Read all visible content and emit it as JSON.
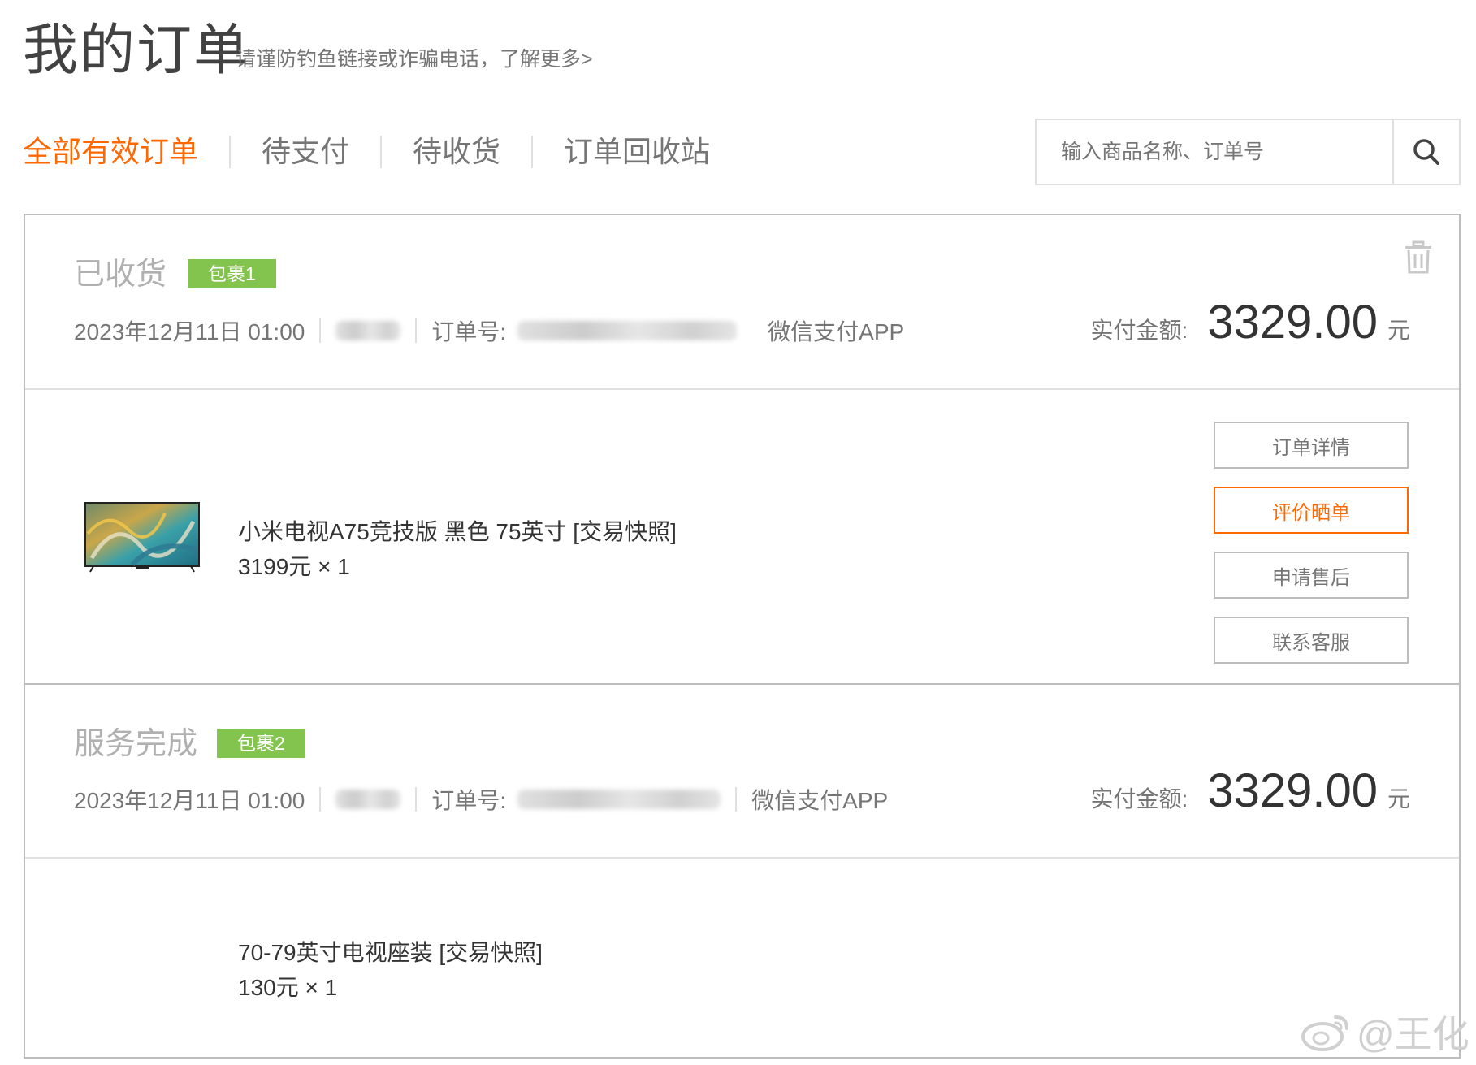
{
  "header": {
    "title": "我的订单",
    "warning_link": "请谨防钓鱼链接或诈骗电话，了解更多>"
  },
  "tabs": [
    {
      "label": "全部有效订单",
      "active": true
    },
    {
      "label": "待支付",
      "active": false
    },
    {
      "label": "待收货",
      "active": false
    },
    {
      "label": "订单回收站",
      "active": false
    }
  ],
  "search": {
    "placeholder": "输入商品名称、订单号",
    "icon": "search-icon"
  },
  "colors": {
    "accent": "#ff6700",
    "badge": "#83c44e",
    "status_text": "#b0b0b0"
  },
  "orders": [
    {
      "status": "已收货",
      "package": "包裹1",
      "datetime": "2023年12月11日 01:00",
      "order_no_label": "订单号:",
      "payment_method": "微信支付APP",
      "paid_label": "实付金额:",
      "paid_amount": "3329.00",
      "paid_unit": "元",
      "item": {
        "name": "小米电视A75竞技版 黑色 75英寸 [交易快照]",
        "price_qty": "3199元 × 1"
      },
      "actions": [
        {
          "label": "订单详情",
          "primary": false
        },
        {
          "label": "评价晒单",
          "primary": true
        },
        {
          "label": "申请售后",
          "primary": false
        },
        {
          "label": "联系客服",
          "primary": false
        }
      ]
    },
    {
      "status": "服务完成",
      "package": "包裹2",
      "datetime": "2023年12月11日 01:00",
      "order_no_label": "订单号:",
      "payment_method": "微信支付APP",
      "paid_label": "实付金额:",
      "paid_amount": "3329.00",
      "paid_unit": "元",
      "item": {
        "name": "70-79英寸电视座装 [交易快照]",
        "price_qty": "130元 × 1"
      }
    }
  ],
  "watermark": "@王化"
}
